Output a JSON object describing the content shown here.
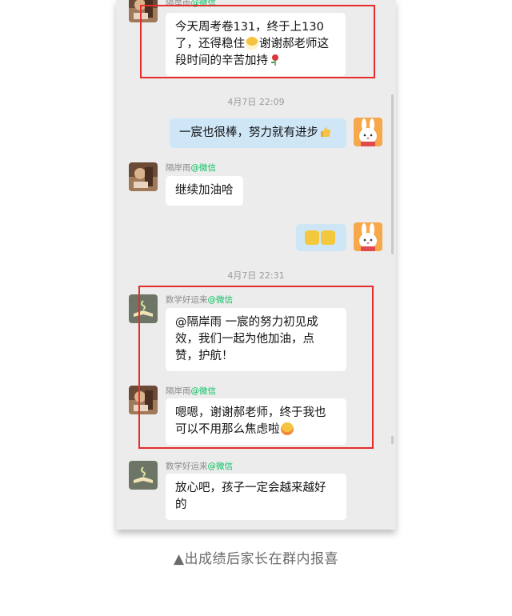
{
  "chat": {
    "messages": [
      {
        "sender_name": "隔岸雨",
        "sender_source": "@微信",
        "lines": [
          "今天周考卷131，终于上130",
          "了，还得稳住",
          "谢谢郝老师这",
          "段时间的辛苦加持"
        ]
      },
      {
        "timestamp": "4月7日  22:09"
      },
      {
        "mine": true,
        "text": "一宸也很棒，努力就有进步"
      },
      {
        "sender_name": "隔岸雨",
        "sender_source": "@微信",
        "text": "继续加油哈"
      },
      {
        "timestamp": "4月7日  22:31"
      },
      {
        "sender_name": "数学好运来",
        "sender_source": "@微信",
        "lines": [
          "@隔岸雨 一宸的努力初见成",
          "效，我们一起为他加油，点",
          "赞，护航！"
        ]
      },
      {
        "sender_name": "隔岸雨",
        "sender_source": "@微信",
        "lines": [
          "嗯嗯，谢谢郝老师，终于我也",
          "可以不用那么焦虑啦"
        ]
      },
      {
        "sender_name": "数学好运来",
        "sender_source": "@微信",
        "lines": [
          "放心吧，孩子一定会越来越好",
          "的"
        ]
      }
    ]
  },
  "caption": "▲出成绩后家长在群内报喜",
  "colors": {
    "highlight": "#e52d2d",
    "chat_background": "#ececec",
    "mine_bubble": "#cfe6f7",
    "source_green": "#07c160"
  },
  "icons": {
    "grin_emoji": "grinning-face-emoji",
    "rose_emoji": "rose-emoji",
    "thumbs_up_emoji": "thumbs-up-emoji",
    "cat_face_emoji": "yellow-cat-face-emoji",
    "sad_emoji": "worried-face-emoji",
    "parent_avatar": "brown-photo-avatar",
    "teacher_avatar": "book-avatar",
    "self_avatar": "bunny-avatar"
  }
}
